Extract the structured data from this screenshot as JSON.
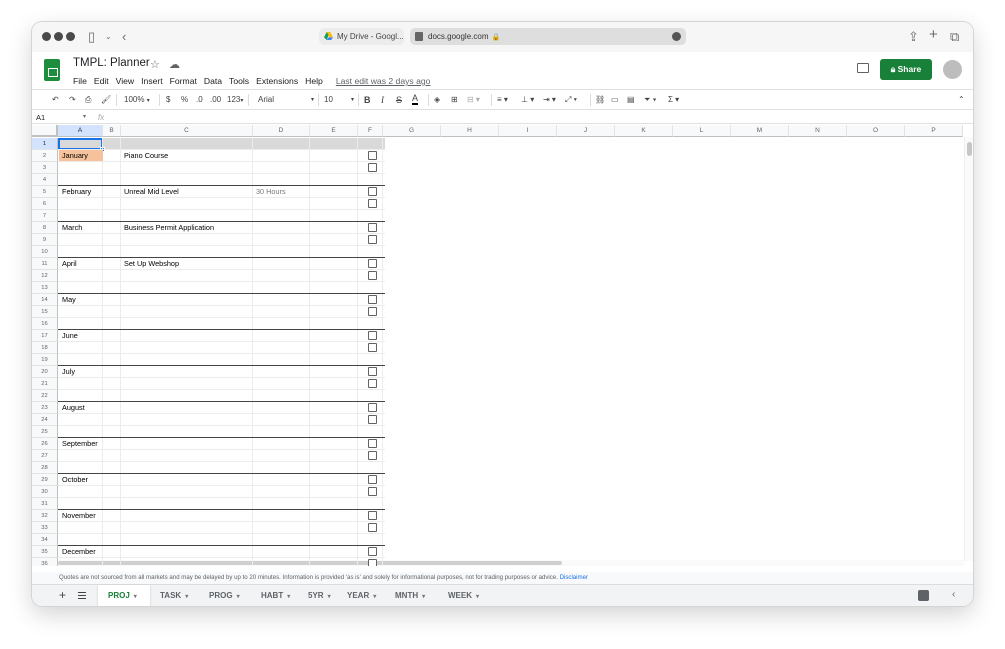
{
  "browser": {
    "tab_inactive_title": "My Drive - Googl...",
    "address": "docs.google.com"
  },
  "doc": {
    "title": "TMPL: Planner",
    "menu": [
      "File",
      "Edit",
      "View",
      "Insert",
      "Format",
      "Data",
      "Tools",
      "Extensions",
      "Help"
    ],
    "last_edit": "Last edit was 2 days ago",
    "share_label": "Share"
  },
  "toolbar": {
    "zoom": "100%",
    "currency": "$",
    "percent": "%",
    "dec_decrease": ".0",
    "dec_increase": ".00",
    "number_format": "123",
    "font": "Arial",
    "font_size": "10",
    "bold": "B",
    "italic": "I",
    "strike": "S",
    "text_color": "A"
  },
  "formula_bar": {
    "cell_ref": "A1",
    "fx": "fx"
  },
  "columns": [
    "A",
    "B",
    "C",
    "D",
    "E",
    "F",
    "G",
    "H",
    "I",
    "J",
    "K",
    "L",
    "M",
    "N",
    "O",
    "P"
  ],
  "rows": [
    "1",
    "2",
    "3",
    "4",
    "5",
    "6",
    "7",
    "8",
    "9",
    "10",
    "11",
    "12",
    "13",
    "14",
    "15",
    "16",
    "17",
    "18",
    "19",
    "20",
    "21",
    "22",
    "23",
    "24",
    "25",
    "26",
    "27",
    "28",
    "29",
    "30",
    "31",
    "32",
    "33",
    "34",
    "35",
    "36"
  ],
  "entries": [
    {
      "month": "January",
      "project": "Piano Course",
      "note": ""
    },
    {
      "month": "February",
      "project": "Unreal Mid Level",
      "note": "30 Hours"
    },
    {
      "month": "March",
      "project": "Business Permit Application",
      "note": ""
    },
    {
      "month": "April",
      "project": "Set Up Webshop",
      "note": ""
    },
    {
      "month": "May",
      "project": "",
      "note": ""
    },
    {
      "month": "June",
      "project": "",
      "note": ""
    },
    {
      "month": "July",
      "project": "",
      "note": ""
    },
    {
      "month": "August",
      "project": "",
      "note": ""
    },
    {
      "month": "September",
      "project": "",
      "note": ""
    },
    {
      "month": "October",
      "project": "",
      "note": ""
    },
    {
      "month": "November",
      "project": "",
      "note": ""
    },
    {
      "month": "December",
      "project": "",
      "note": ""
    }
  ],
  "disclaimer": {
    "text": "Quotes are not sourced from all markets and may be delayed by up to 20 minutes. Information is provided 'as is' and solely for informational purposes, not for trading purposes or advice.",
    "link": "Disclaimer"
  },
  "sheet_tabs": [
    "PROJ",
    "TASK",
    "PROG",
    "HABT",
    "5YR",
    "YEAR",
    "MNTH",
    "WEEK"
  ],
  "active_sheet": "PROJ",
  "colors": {
    "sheets_green": "#188038",
    "month_highlight": "#f6c29b",
    "selection_blue": "#1a73e8",
    "header_band": "#d9d9d9"
  }
}
